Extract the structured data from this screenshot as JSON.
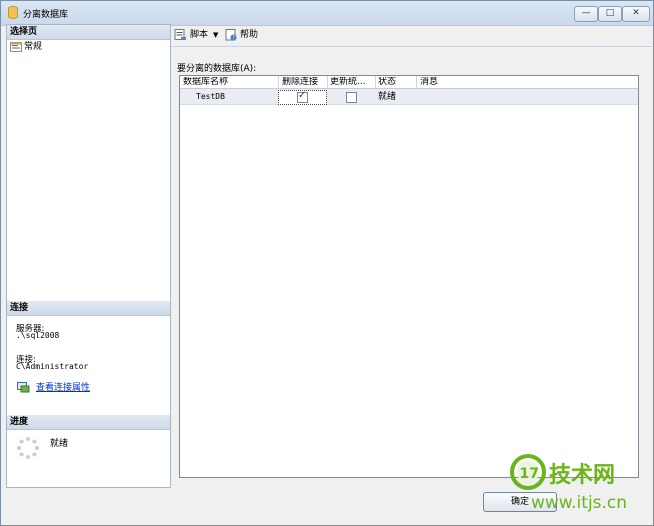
{
  "window": {
    "title": "分离数据库",
    "controls": {
      "minimize": "—",
      "maximize": "□",
      "close": "✕"
    }
  },
  "left": {
    "select_page_header": "选择页",
    "pages": [
      {
        "label": "常规",
        "icon": "settings-page-icon"
      }
    ],
    "connection": {
      "header": "连接",
      "server_label": "服务器:",
      "server_value": ".\\sql2008",
      "conn_label": "连接:",
      "conn_value": "C\\Administrator",
      "link_label": "查看连接属性"
    },
    "progress": {
      "header": "进度",
      "status": "就绪"
    }
  },
  "toolbar": {
    "script_label": "脚本",
    "script_dropdown": "▼",
    "help_label": "帮助"
  },
  "grid": {
    "caption": "要分离的数据库(A):",
    "columns": [
      "数据库名称",
      "删除连接",
      "更新统...",
      "状态",
      "消息"
    ],
    "rows": [
      {
        "name": "TestDB",
        "drop_connections": true,
        "update_stats": false,
        "status": "就绪",
        "message": ""
      }
    ]
  },
  "buttons": {
    "ok_label": "确定"
  },
  "watermark": {
    "logo_text": "17",
    "brand": "技术网",
    "url": "www.itjs.cn"
  },
  "colors": {
    "accent": "#3a7bd5",
    "link": "#0033cc",
    "watermark": "#6bb51a"
  }
}
